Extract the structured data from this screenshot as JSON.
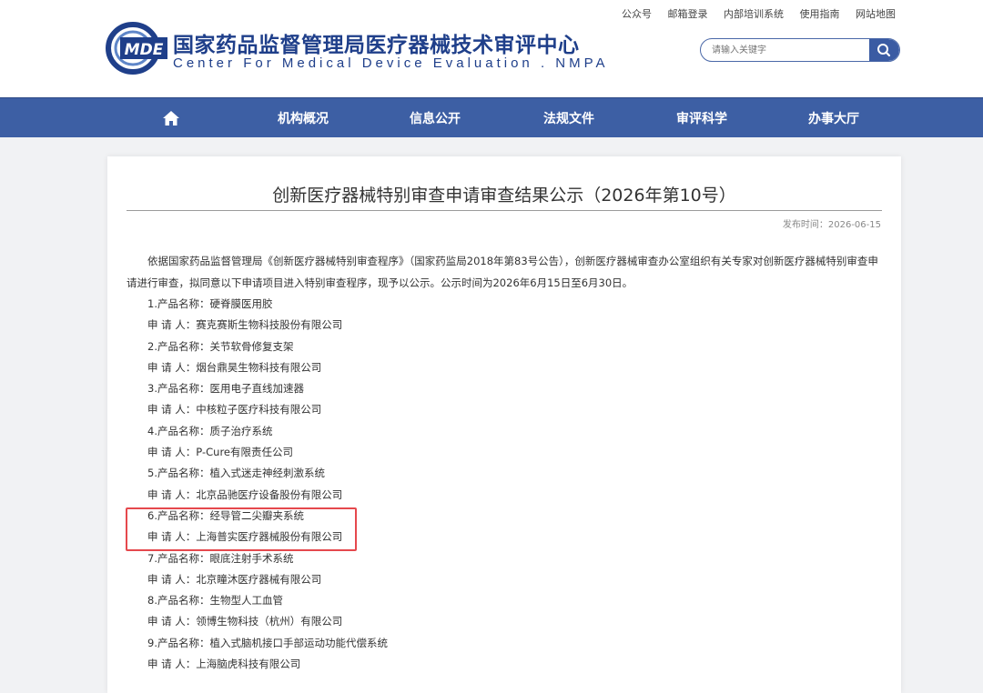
{
  "header": {
    "top_links": [
      "公众号",
      "邮箱登录",
      "内部培训系统",
      "使用指南",
      "网站地图"
    ],
    "logo_text": "MDE",
    "site_name_cn": "国家药品监督管理局医疗器械技术审评中心",
    "site_name_en": "Center For Medical Device Evaluation . NMPA",
    "search_placeholder": "请输入关键字"
  },
  "nav": {
    "home_icon": "home-icon",
    "items": [
      "机构概况",
      "信息公开",
      "法规文件",
      "审评科学",
      "办事大厅"
    ]
  },
  "article": {
    "title": "创新医疗器械特别审查申请审查结果公示（2026年第10号）",
    "publish_date": "发布时间：2026-06-15",
    "intro": "依据国家药品监督管理局《创新医疗器械特别审查程序》（国家药监局2018年第83号公告），创新医疗器械审查办公室组织有关专家对创新医疗器械特别审查申请进行审查，拟同意以下申请项目进入特别审查程序，现予以公示。公示时间为2026年6月15日至6月30日。",
    "items": [
      {
        "product": "1.产品名称：硬脊膜医用胶",
        "applicant": "申 请 人：赛克赛斯生物科技股份有限公司"
      },
      {
        "product": "2.产品名称：关节软骨修复支架",
        "applicant": "申 请 人：烟台鼎昊生物科技有限公司"
      },
      {
        "product": "3.产品名称：医用电子直线加速器",
        "applicant": "申 请 人：中核粒子医疗科技有限公司"
      },
      {
        "product": "4.产品名称：质子治疗系统",
        "applicant": "申 请 人：P-Cure有限责任公司"
      },
      {
        "product": "5.产品名称：植入式迷走神经刺激系统",
        "applicant": "申 请 人：北京品驰医疗设备股份有限公司"
      },
      {
        "product": "6.产品名称：经导管二尖瓣夹系统",
        "applicant": "申 请 人：上海普实医疗器械股份有限公司"
      },
      {
        "product": "7.产品名称：眼底注射手术系统",
        "applicant": "申 请 人：北京瞳沐医疗器械有限公司"
      },
      {
        "product": "8.产品名称：生物型人工血管",
        "applicant": "申 请 人：领博生物科技（杭州）有限公司"
      },
      {
        "product": "9.产品名称：植入式脑机接口手部运动功能代偿系统",
        "applicant": "申 请 人：上海脑虎科技有限公司"
      }
    ]
  },
  "colors": {
    "nav_bg": "#3d5fa4",
    "brand_blue": "#1f3f8a",
    "highlight_border": "#e5484d"
  }
}
